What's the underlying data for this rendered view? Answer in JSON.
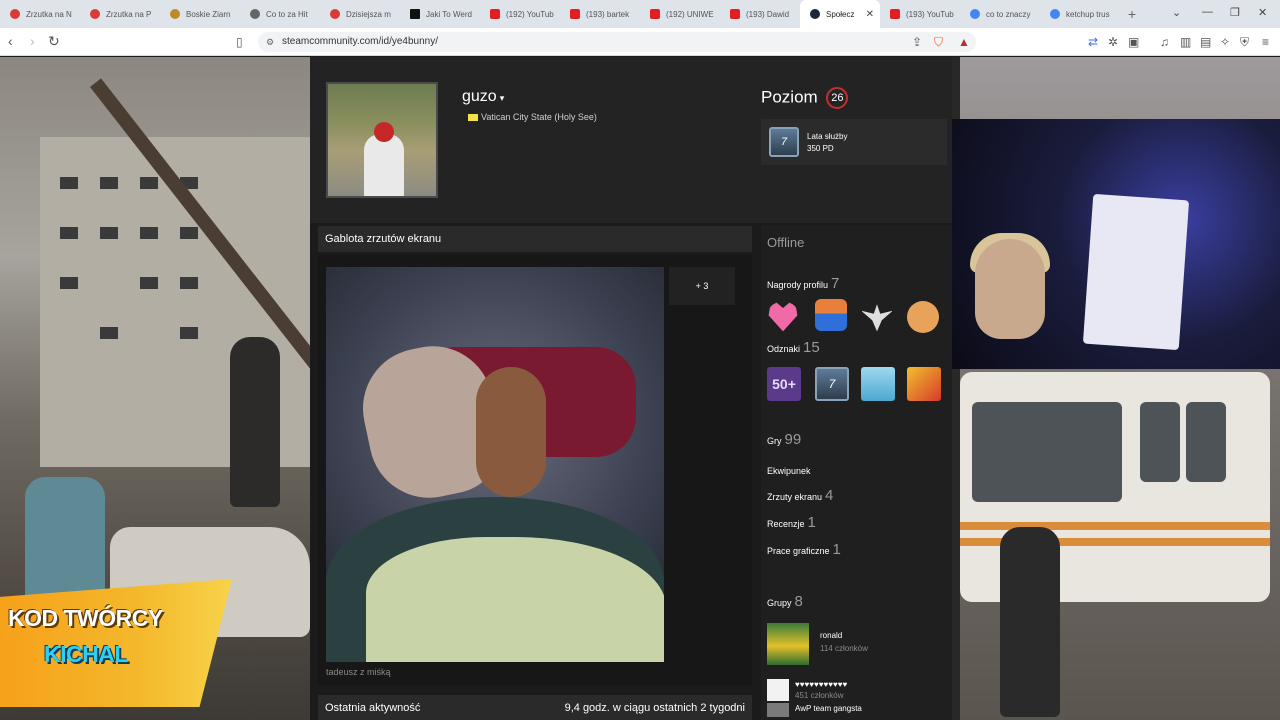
{
  "browser": {
    "tabs": [
      {
        "label": "Zrzutka na N",
        "color": "#d93a3a"
      },
      {
        "label": "Zrzutka na P",
        "color": "#d93a3a"
      },
      {
        "label": "Boskie Ziarn",
        "color": "#c08a2a"
      },
      {
        "label": "Co to za Hit",
        "color": "#666666"
      },
      {
        "label": "Dzisiejsza m",
        "color": "#d93a3a"
      },
      {
        "label": "Jaki To Werd",
        "color": "#111111"
      },
      {
        "label": "(192) YouTub",
        "color": "#e02020"
      },
      {
        "label": "(193) bartek",
        "color": "#e02020"
      },
      {
        "label": "(192) UNIWE",
        "color": "#e02020"
      },
      {
        "label": "(193) Dawid",
        "color": "#e02020"
      },
      {
        "label": "Społecz",
        "color": "#1b2838"
      },
      {
        "label": "(193) YouTub",
        "color": "#e02020"
      },
      {
        "label": "co to znaczy",
        "color": "#4285f4"
      },
      {
        "label": "ketchup trus",
        "color": "#4285f4"
      }
    ],
    "url": "steamcommunity.com/id/ye4bunny/"
  },
  "profile": {
    "username": "guzo",
    "location": "Vatican City State (Holy See)",
    "level_label": "Poziom",
    "level": "26",
    "badge_icon_value": "7",
    "badge_name": "Lata służby",
    "badge_xp": "350 PD"
  },
  "showcase": {
    "title": "Gablota zrzutów ekranu",
    "more": "+ 3",
    "caption": "tadeusz z miśką"
  },
  "activity": {
    "title": "Ostatnia aktywność",
    "summary": "9,4 godz. w ciągu ostatnich 2 tygodni"
  },
  "sidebar": {
    "status": "Offline",
    "awards_label": "Nagrody profilu",
    "awards_count": "7",
    "badges_label": "Odznaki",
    "badges_count": "15",
    "badge_50": "50+",
    "badge_7": "7",
    "games_label": "Gry",
    "games_count": "99",
    "inventory_label": "Ekwipunek",
    "screenshots_label": "Zrzuty ekranu",
    "screenshots_count": "4",
    "reviews_label": "Recenzje",
    "reviews_count": "1",
    "artwork_label": "Prace graficzne",
    "artwork_count": "1",
    "groups_label": "Grupy",
    "groups_count": "8",
    "groups": [
      {
        "name": "ronald",
        "members": "114 członków"
      },
      {
        "name": "♥♥♥♥♥♥♥♥♥♥♥",
        "members": "451 członków"
      },
      {
        "name": "AwP team gangsta",
        "members": ""
      }
    ]
  },
  "overlay": {
    "creator_line1": "KOD TWÓRCY",
    "creator_line2": "KICHAL"
  }
}
